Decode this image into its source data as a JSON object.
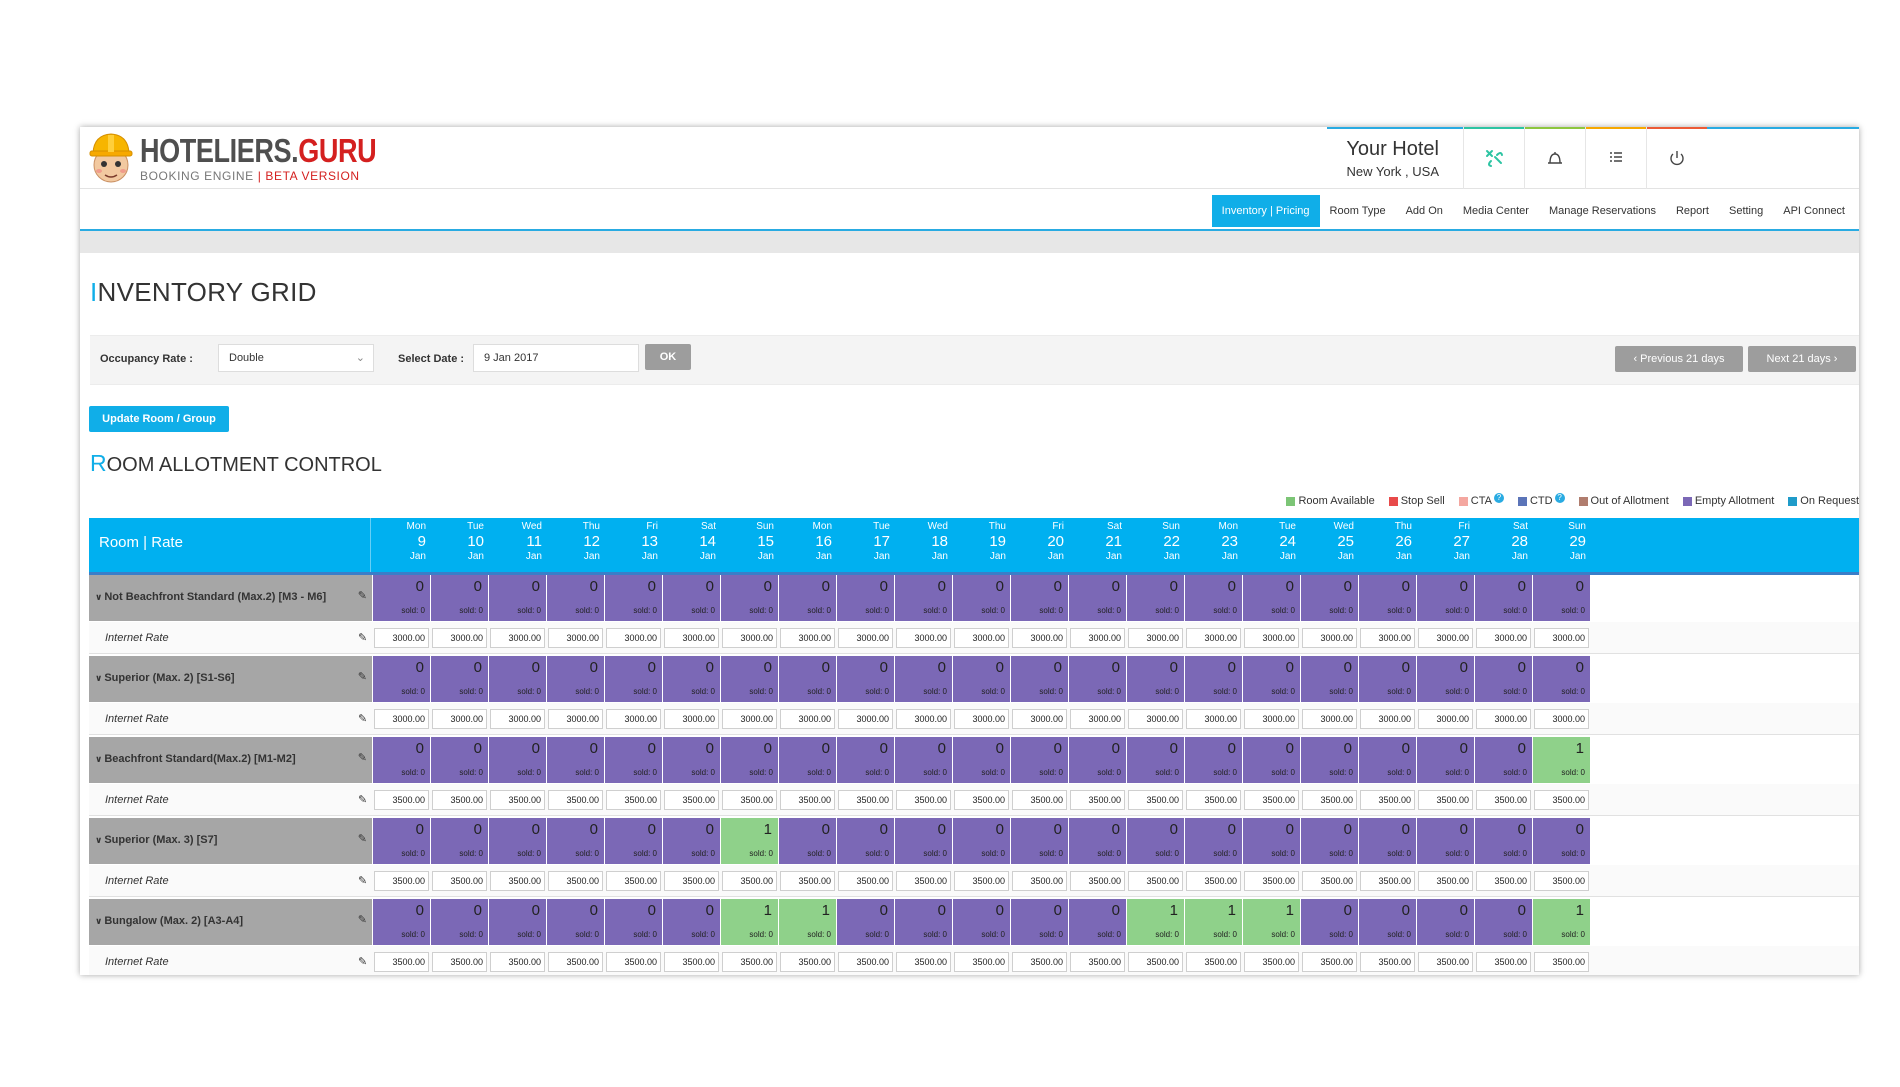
{
  "brand": {
    "name_part1": "HOTELIERS.",
    "name_part2": "GURU",
    "tagline_part1": "BOOKING ENGINE",
    "tagline_sep": "|",
    "tagline_part2": "BETA VERSION"
  },
  "hotel": {
    "name": "Your Hotel",
    "location": "New York , USA"
  },
  "header_icons": [
    {
      "icon": "hotel-settings-icon",
      "bar_color": "#2ec4a3"
    },
    {
      "icon": "bell-icon",
      "bar_color": "#8dc63f"
    },
    {
      "icon": "list-icon",
      "bar_color": "#f6a800"
    },
    {
      "icon": "power-icon",
      "bar_color": "#ec5a36"
    }
  ],
  "nav": [
    {
      "label": "Inventory | Pricing",
      "active": true
    },
    {
      "label": "Room Type"
    },
    {
      "label": "Add On"
    },
    {
      "label": "Media Center"
    },
    {
      "label": "Manage Reservations"
    },
    {
      "label": "Report"
    },
    {
      "label": "Setting"
    },
    {
      "label": "API Connect"
    }
  ],
  "page": {
    "title_first": "I",
    "title_rest": "NVENTORY GRID"
  },
  "filters": {
    "occupancy_label": "Occupancy Rate :",
    "occupancy_value": "Double",
    "date_label": "Select Date :",
    "date_value": "9 Jan 2017",
    "ok_label": "OK",
    "prev_label": "Previous 21 days",
    "next_label": "Next 21 days"
  },
  "update_button": "Update Room / Group",
  "section": {
    "title_first": "R",
    "title_rest": "OOM ALLOTMENT CONTROL"
  },
  "legend": [
    {
      "label": "Room Available",
      "color": "#7cc576"
    },
    {
      "label": "Stop Sell",
      "color": "#e84a4a"
    },
    {
      "label": "CTA",
      "color": "#f4a7a0",
      "help": "?"
    },
    {
      "label": "CTD",
      "color": "#5b74b8",
      "help": "?"
    },
    {
      "label": "Out of Allotment",
      "color": "#b07d6e"
    },
    {
      "label": "Empty Allotment",
      "color": "#7b68b6"
    },
    {
      "label": "On Request",
      "color": "#1f9bc9"
    }
  ],
  "grid": {
    "header_label": "Room | Rate",
    "days": [
      {
        "dow": "Mon",
        "day": "9",
        "mon": "Jan"
      },
      {
        "dow": "Tue",
        "day": "10",
        "mon": "Jan"
      },
      {
        "dow": "Wed",
        "day": "11",
        "mon": "Jan"
      },
      {
        "dow": "Thu",
        "day": "12",
        "mon": "Jan"
      },
      {
        "dow": "Fri",
        "day": "13",
        "mon": "Jan"
      },
      {
        "dow": "Sat",
        "day": "14",
        "mon": "Jan"
      },
      {
        "dow": "Sun",
        "day": "15",
        "mon": "Jan"
      },
      {
        "dow": "Mon",
        "day": "16",
        "mon": "Jan"
      },
      {
        "dow": "Tue",
        "day": "17",
        "mon": "Jan"
      },
      {
        "dow": "Wed",
        "day": "18",
        "mon": "Jan"
      },
      {
        "dow": "Thu",
        "day": "19",
        "mon": "Jan"
      },
      {
        "dow": "Fri",
        "day": "20",
        "mon": "Jan"
      },
      {
        "dow": "Sat",
        "day": "21",
        "mon": "Jan"
      },
      {
        "dow": "Sun",
        "day": "22",
        "mon": "Jan"
      },
      {
        "dow": "Mon",
        "day": "23",
        "mon": "Jan"
      },
      {
        "dow": "Tue",
        "day": "24",
        "mon": "Jan"
      },
      {
        "dow": "Wed",
        "day": "25",
        "mon": "Jan"
      },
      {
        "dow": "Thu",
        "day": "26",
        "mon": "Jan"
      },
      {
        "dow": "Fri",
        "day": "27",
        "mon": "Jan"
      },
      {
        "dow": "Sat",
        "day": "28",
        "mon": "Jan"
      },
      {
        "dow": "Sun",
        "day": "29",
        "mon": "Jan"
      }
    ],
    "sold_prefix": "sold: ",
    "rooms": [
      {
        "name": "Not Beachfront Standard (Max.2) [M3 - M6]",
        "allotment": [
          0,
          0,
          0,
          0,
          0,
          0,
          0,
          0,
          0,
          0,
          0,
          0,
          0,
          0,
          0,
          0,
          0,
          0,
          0,
          0,
          0
        ],
        "sold": [
          0,
          0,
          0,
          0,
          0,
          0,
          0,
          0,
          0,
          0,
          0,
          0,
          0,
          0,
          0,
          0,
          0,
          0,
          0,
          0,
          0
        ],
        "rate_label": "Internet Rate",
        "rates": [
          "3000.00",
          "3000.00",
          "3000.00",
          "3000.00",
          "3000.00",
          "3000.00",
          "3000.00",
          "3000.00",
          "3000.00",
          "3000.00",
          "3000.00",
          "3000.00",
          "3000.00",
          "3000.00",
          "3000.00",
          "3000.00",
          "3000.00",
          "3000.00",
          "3000.00",
          "3000.00",
          "3000.00"
        ]
      },
      {
        "name": "Superior (Max. 2) [S1-S6]",
        "allotment": [
          0,
          0,
          0,
          0,
          0,
          0,
          0,
          0,
          0,
          0,
          0,
          0,
          0,
          0,
          0,
          0,
          0,
          0,
          0,
          0,
          0
        ],
        "sold": [
          0,
          0,
          0,
          0,
          0,
          0,
          0,
          0,
          0,
          0,
          0,
          0,
          0,
          0,
          0,
          0,
          0,
          0,
          0,
          0,
          0
        ],
        "rate_label": "Internet Rate",
        "rates": [
          "3000.00",
          "3000.00",
          "3000.00",
          "3000.00",
          "3000.00",
          "3000.00",
          "3000.00",
          "3000.00",
          "3000.00",
          "3000.00",
          "3000.00",
          "3000.00",
          "3000.00",
          "3000.00",
          "3000.00",
          "3000.00",
          "3000.00",
          "3000.00",
          "3000.00",
          "3000.00",
          "3000.00"
        ]
      },
      {
        "name": "Beachfront Standard(Max.2) [M1-M2]",
        "allotment": [
          0,
          0,
          0,
          0,
          0,
          0,
          0,
          0,
          0,
          0,
          0,
          0,
          0,
          0,
          0,
          0,
          0,
          0,
          0,
          0,
          1
        ],
        "sold": [
          0,
          0,
          0,
          0,
          0,
          0,
          0,
          0,
          0,
          0,
          0,
          0,
          0,
          0,
          0,
          0,
          0,
          0,
          0,
          0,
          0
        ],
        "rate_label": "Internet Rate",
        "rates": [
          "3500.00",
          "3500.00",
          "3500.00",
          "3500.00",
          "3500.00",
          "3500.00",
          "3500.00",
          "3500.00",
          "3500.00",
          "3500.00",
          "3500.00",
          "3500.00",
          "3500.00",
          "3500.00",
          "3500.00",
          "3500.00",
          "3500.00",
          "3500.00",
          "3500.00",
          "3500.00",
          "3500.00"
        ]
      },
      {
        "name": "Superior (Max. 3) [S7]",
        "allotment": [
          0,
          0,
          0,
          0,
          0,
          0,
          1,
          0,
          0,
          0,
          0,
          0,
          0,
          0,
          0,
          0,
          0,
          0,
          0,
          0,
          0
        ],
        "sold": [
          0,
          0,
          0,
          0,
          0,
          0,
          0,
          0,
          0,
          0,
          0,
          0,
          0,
          0,
          0,
          0,
          0,
          0,
          0,
          0,
          0
        ],
        "rate_label": "Internet Rate",
        "rates": [
          "3500.00",
          "3500.00",
          "3500.00",
          "3500.00",
          "3500.00",
          "3500.00",
          "3500.00",
          "3500.00",
          "3500.00",
          "3500.00",
          "3500.00",
          "3500.00",
          "3500.00",
          "3500.00",
          "3500.00",
          "3500.00",
          "3500.00",
          "3500.00",
          "3500.00",
          "3500.00",
          "3500.00"
        ]
      },
      {
        "name": "Bungalow (Max. 2) [A3-A4]",
        "allotment": [
          0,
          0,
          0,
          0,
          0,
          0,
          1,
          1,
          0,
          0,
          0,
          0,
          0,
          1,
          1,
          1,
          0,
          0,
          0,
          0,
          1
        ],
        "sold": [
          0,
          0,
          0,
          0,
          0,
          0,
          0,
          0,
          0,
          0,
          0,
          0,
          0,
          0,
          0,
          0,
          0,
          0,
          0,
          0,
          0
        ],
        "rate_label": "Internet Rate",
        "rates": [
          "3500.00",
          "3500.00",
          "3500.00",
          "3500.00",
          "3500.00",
          "3500.00",
          "3500.00",
          "3500.00",
          "3500.00",
          "3500.00",
          "3500.00",
          "3500.00",
          "3500.00",
          "3500.00",
          "3500.00",
          "3500.00",
          "3500.00",
          "3500.00",
          "3500.00",
          "3500.00",
          "3500.00"
        ]
      }
    ]
  }
}
